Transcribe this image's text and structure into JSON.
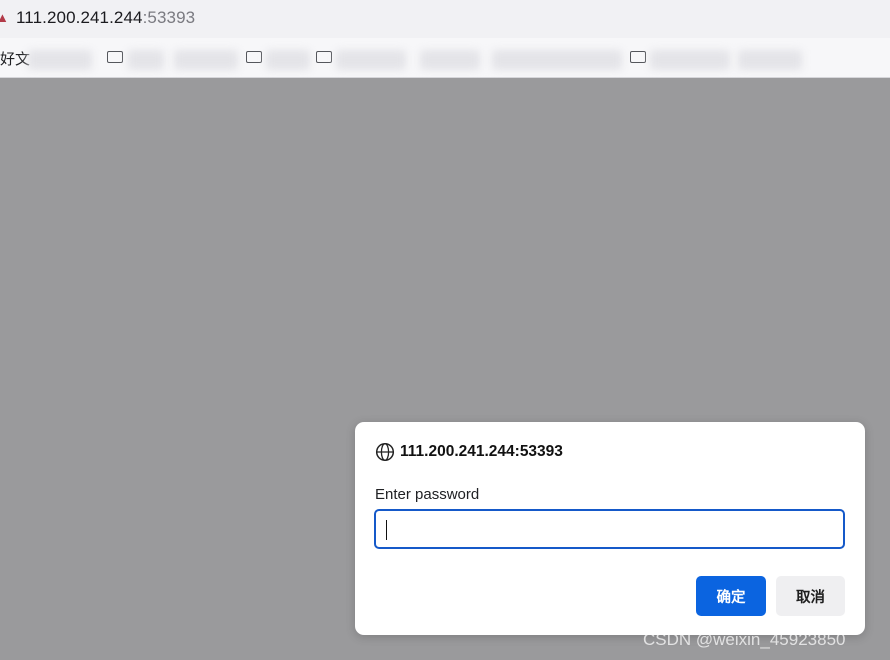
{
  "browser": {
    "url_host": "111.200.241.244",
    "url_port": ":53393"
  },
  "bookmarks": {
    "first_label": "好文"
  },
  "dialog": {
    "origin": "111.200.241.244:53393",
    "label": "Enter password",
    "input_value": "",
    "ok_label": "确定",
    "cancel_label": "取消"
  },
  "watermark": "CSDN @weixin_45923850",
  "colors": {
    "overlay": "#9a9a9c",
    "primary_button": "#0b64e0",
    "input_focus_border": "#1559c9"
  }
}
